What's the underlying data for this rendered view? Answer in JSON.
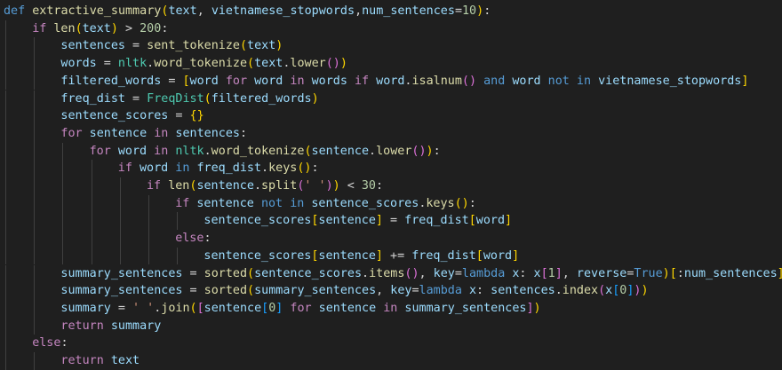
{
  "editor": {
    "colors": {
      "background": "#1f1f1f",
      "kw": "#569cd6",
      "ctl": "#c586c0",
      "fn": "#dcdcaa",
      "cls": "#4ec9b0",
      "var": "#9cdcfe",
      "num": "#b5cea8",
      "str": "#ce9178",
      "op": "#d4d4d4",
      "b1": "#ffd700",
      "b2": "#da70d6",
      "b3": "#179fff"
    },
    "lines": [
      {
        "indent": 0,
        "tokens": [
          [
            "kw",
            "def"
          ],
          [
            "op",
            " "
          ],
          [
            "fn",
            "extractive_summary"
          ],
          [
            "b1",
            "("
          ],
          [
            "var",
            "text"
          ],
          [
            "op",
            ", "
          ],
          [
            "var",
            "vietnamese_stopwords"
          ],
          [
            "op",
            ","
          ],
          [
            "var",
            "num_sentences"
          ],
          [
            "op",
            "="
          ],
          [
            "num",
            "10"
          ],
          [
            "b1",
            ")"
          ],
          [
            "op",
            ":"
          ]
        ]
      },
      {
        "indent": 1,
        "tokens": [
          [
            "ctl",
            "if"
          ],
          [
            "op",
            " "
          ],
          [
            "fn",
            "len"
          ],
          [
            "b1",
            "("
          ],
          [
            "var",
            "text"
          ],
          [
            "b1",
            ")"
          ],
          [
            "op",
            " > "
          ],
          [
            "num",
            "200"
          ],
          [
            "op",
            ":"
          ]
        ]
      },
      {
        "indent": 2,
        "tokens": [
          [
            "var",
            "sentences"
          ],
          [
            "op",
            " = "
          ],
          [
            "fn",
            "sent_tokenize"
          ],
          [
            "b1",
            "("
          ],
          [
            "var",
            "text"
          ],
          [
            "b1",
            ")"
          ]
        ]
      },
      {
        "indent": 2,
        "tokens": [
          [
            "var",
            "words"
          ],
          [
            "op",
            " = "
          ],
          [
            "cls",
            "nltk"
          ],
          [
            "op",
            "."
          ],
          [
            "fn",
            "word_tokenize"
          ],
          [
            "b1",
            "("
          ],
          [
            "var",
            "text"
          ],
          [
            "op",
            "."
          ],
          [
            "fn",
            "lower"
          ],
          [
            "b2",
            "()"
          ],
          [
            "b1",
            ")"
          ]
        ]
      },
      {
        "indent": 2,
        "tokens": [
          [
            "var",
            "filtered_words"
          ],
          [
            "op",
            " = "
          ],
          [
            "b1",
            "["
          ],
          [
            "var",
            "word"
          ],
          [
            "op",
            " "
          ],
          [
            "ctl",
            "for"
          ],
          [
            "op",
            " "
          ],
          [
            "var",
            "word"
          ],
          [
            "op",
            " "
          ],
          [
            "ctl",
            "in"
          ],
          [
            "op",
            " "
          ],
          [
            "var",
            "words"
          ],
          [
            "op",
            " "
          ],
          [
            "ctl",
            "if"
          ],
          [
            "op",
            " "
          ],
          [
            "var",
            "word"
          ],
          [
            "op",
            "."
          ],
          [
            "fn",
            "isalnum"
          ],
          [
            "b2",
            "()"
          ],
          [
            "op",
            " "
          ],
          [
            "kw",
            "and"
          ],
          [
            "op",
            " "
          ],
          [
            "var",
            "word"
          ],
          [
            "op",
            " "
          ],
          [
            "kw",
            "not"
          ],
          [
            "op",
            " "
          ],
          [
            "kw",
            "in"
          ],
          [
            "op",
            " "
          ],
          [
            "var",
            "vietnamese_stopwords"
          ],
          [
            "b1",
            "]"
          ]
        ]
      },
      {
        "indent": 2,
        "tokens": [
          [
            "var",
            "freq_dist"
          ],
          [
            "op",
            " = "
          ],
          [
            "cls",
            "FreqDist"
          ],
          [
            "b1",
            "("
          ],
          [
            "var",
            "filtered_words"
          ],
          [
            "b1",
            ")"
          ]
        ]
      },
      {
        "indent": 2,
        "tokens": [
          [
            "var",
            "sentence_scores"
          ],
          [
            "op",
            " = "
          ],
          [
            "b1",
            "{}"
          ]
        ]
      },
      {
        "indent": 2,
        "tokens": [
          [
            "ctl",
            "for"
          ],
          [
            "op",
            " "
          ],
          [
            "var",
            "sentence"
          ],
          [
            "op",
            " "
          ],
          [
            "ctl",
            "in"
          ],
          [
            "op",
            " "
          ],
          [
            "var",
            "sentences"
          ],
          [
            "op",
            ":"
          ]
        ]
      },
      {
        "indent": 3,
        "tokens": [
          [
            "ctl",
            "for"
          ],
          [
            "op",
            " "
          ],
          [
            "var",
            "word"
          ],
          [
            "op",
            " "
          ],
          [
            "ctl",
            "in"
          ],
          [
            "op",
            " "
          ],
          [
            "cls",
            "nltk"
          ],
          [
            "op",
            "."
          ],
          [
            "fn",
            "word_tokenize"
          ],
          [
            "b1",
            "("
          ],
          [
            "var",
            "sentence"
          ],
          [
            "op",
            "."
          ],
          [
            "fn",
            "lower"
          ],
          [
            "b2",
            "()"
          ],
          [
            "b1",
            ")"
          ],
          [
            "op",
            ":"
          ]
        ]
      },
      {
        "indent": 4,
        "tokens": [
          [
            "ctl",
            "if"
          ],
          [
            "op",
            " "
          ],
          [
            "var",
            "word"
          ],
          [
            "op",
            " "
          ],
          [
            "kw",
            "in"
          ],
          [
            "op",
            " "
          ],
          [
            "var",
            "freq_dist"
          ],
          [
            "op",
            "."
          ],
          [
            "fn",
            "keys"
          ],
          [
            "b1",
            "()"
          ],
          [
            "op",
            ":"
          ]
        ]
      },
      {
        "indent": 5,
        "tokens": [
          [
            "ctl",
            "if"
          ],
          [
            "op",
            " "
          ],
          [
            "fn",
            "len"
          ],
          [
            "b1",
            "("
          ],
          [
            "var",
            "sentence"
          ],
          [
            "op",
            "."
          ],
          [
            "fn",
            "split"
          ],
          [
            "b2",
            "("
          ],
          [
            "str",
            "' '"
          ],
          [
            "b2",
            ")"
          ],
          [
            "b1",
            ")"
          ],
          [
            "op",
            " < "
          ],
          [
            "num",
            "30"
          ],
          [
            "op",
            ":"
          ]
        ]
      },
      {
        "indent": 6,
        "tokens": [
          [
            "ctl",
            "if"
          ],
          [
            "op",
            " "
          ],
          [
            "var",
            "sentence"
          ],
          [
            "op",
            " "
          ],
          [
            "kw",
            "not"
          ],
          [
            "op",
            " "
          ],
          [
            "kw",
            "in"
          ],
          [
            "op",
            " "
          ],
          [
            "var",
            "sentence_scores"
          ],
          [
            "op",
            "."
          ],
          [
            "fn",
            "keys"
          ],
          [
            "b1",
            "()"
          ],
          [
            "op",
            ":"
          ]
        ]
      },
      {
        "indent": 7,
        "tokens": [
          [
            "var",
            "sentence_scores"
          ],
          [
            "b1",
            "["
          ],
          [
            "var",
            "sentence"
          ],
          [
            "b1",
            "]"
          ],
          [
            "op",
            " = "
          ],
          [
            "var",
            "freq_dist"
          ],
          [
            "b1",
            "["
          ],
          [
            "var",
            "word"
          ],
          [
            "b1",
            "]"
          ]
        ]
      },
      {
        "indent": 6,
        "tokens": [
          [
            "ctl",
            "else"
          ],
          [
            "op",
            ":"
          ]
        ]
      },
      {
        "indent": 7,
        "tokens": [
          [
            "var",
            "sentence_scores"
          ],
          [
            "b1",
            "["
          ],
          [
            "var",
            "sentence"
          ],
          [
            "b1",
            "]"
          ],
          [
            "op",
            " += "
          ],
          [
            "var",
            "freq_dist"
          ],
          [
            "b1",
            "["
          ],
          [
            "var",
            "word"
          ],
          [
            "b1",
            "]"
          ]
        ]
      },
      {
        "indent": 2,
        "tokens": [
          [
            "var",
            "summary_sentences"
          ],
          [
            "op",
            " = "
          ],
          [
            "fn",
            "sorted"
          ],
          [
            "b1",
            "("
          ],
          [
            "var",
            "sentence_scores"
          ],
          [
            "op",
            "."
          ],
          [
            "fn",
            "items"
          ],
          [
            "b2",
            "()"
          ],
          [
            "op",
            ", "
          ],
          [
            "var",
            "key"
          ],
          [
            "op",
            "="
          ],
          [
            "kw",
            "lambda"
          ],
          [
            "op",
            " "
          ],
          [
            "var",
            "x"
          ],
          [
            "op",
            ": "
          ],
          [
            "var",
            "x"
          ],
          [
            "b2",
            "["
          ],
          [
            "num",
            "1"
          ],
          [
            "b2",
            "]"
          ],
          [
            "op",
            ", "
          ],
          [
            "var",
            "reverse"
          ],
          [
            "op",
            "="
          ],
          [
            "kw",
            "True"
          ],
          [
            "b1",
            ")"
          ],
          [
            "b1",
            "["
          ],
          [
            "op",
            ":"
          ],
          [
            "var",
            "num_sentences"
          ],
          [
            "b1",
            "]"
          ]
        ]
      },
      {
        "indent": 2,
        "tokens": [
          [
            "var",
            "summary_sentences"
          ],
          [
            "op",
            " = "
          ],
          [
            "fn",
            "sorted"
          ],
          [
            "b1",
            "("
          ],
          [
            "var",
            "summary_sentences"
          ],
          [
            "op",
            ", "
          ],
          [
            "var",
            "key"
          ],
          [
            "op",
            "="
          ],
          [
            "kw",
            "lambda"
          ],
          [
            "op",
            " "
          ],
          [
            "var",
            "x"
          ],
          [
            "op",
            ": "
          ],
          [
            "var",
            "sentences"
          ],
          [
            "op",
            "."
          ],
          [
            "fn",
            "index"
          ],
          [
            "b2",
            "("
          ],
          [
            "var",
            "x"
          ],
          [
            "b3",
            "["
          ],
          [
            "num",
            "0"
          ],
          [
            "b3",
            "]"
          ],
          [
            "b2",
            ")"
          ],
          [
            "b1",
            ")"
          ]
        ]
      },
      {
        "indent": 2,
        "tokens": [
          [
            "var",
            "summary"
          ],
          [
            "op",
            " = "
          ],
          [
            "str",
            "' '"
          ],
          [
            "op",
            "."
          ],
          [
            "fn",
            "join"
          ],
          [
            "b1",
            "("
          ],
          [
            "b2",
            "["
          ],
          [
            "var",
            "sentence"
          ],
          [
            "b3",
            "["
          ],
          [
            "num",
            "0"
          ],
          [
            "b3",
            "]"
          ],
          [
            "op",
            " "
          ],
          [
            "ctl",
            "for"
          ],
          [
            "op",
            " "
          ],
          [
            "var",
            "sentence"
          ],
          [
            "op",
            " "
          ],
          [
            "ctl",
            "in"
          ],
          [
            "op",
            " "
          ],
          [
            "var",
            "summary_sentences"
          ],
          [
            "b2",
            "]"
          ],
          [
            "b1",
            ")"
          ]
        ]
      },
      {
        "indent": 2,
        "tokens": [
          [
            "ctl",
            "return"
          ],
          [
            "op",
            " "
          ],
          [
            "var",
            "summary"
          ]
        ]
      },
      {
        "indent": 1,
        "tokens": [
          [
            "ctl",
            "else"
          ],
          [
            "op",
            ":"
          ]
        ]
      },
      {
        "indent": 2,
        "tokens": [
          [
            "ctl",
            "return"
          ],
          [
            "op",
            " "
          ],
          [
            "var",
            "text"
          ]
        ]
      }
    ]
  }
}
